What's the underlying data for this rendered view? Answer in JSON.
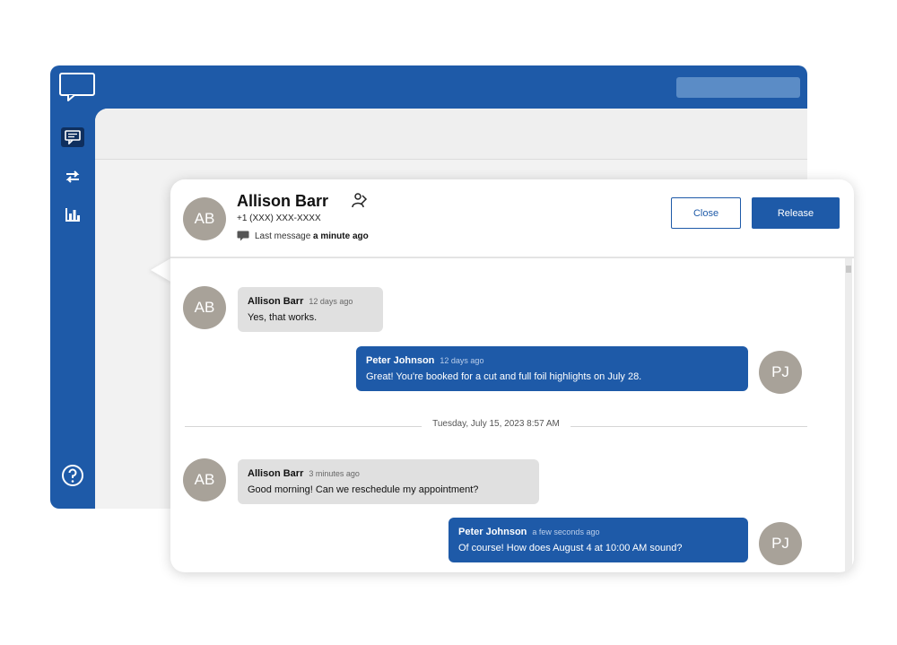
{
  "sidebar": {
    "logo_icon": "chat-bubble-icon",
    "items": [
      {
        "name": "messages",
        "icon": "message-icon",
        "active": true
      },
      {
        "name": "transfers",
        "icon": "transfer-arrows-icon",
        "active": false
      },
      {
        "name": "reports",
        "icon": "bar-chart-icon",
        "active": false
      }
    ],
    "help_icon": "help-icon"
  },
  "conversation": {
    "contact": {
      "initials": "AB",
      "name": "Allison Barr",
      "phone": "+1 (XXX) XXX-XXXX",
      "last_message_prefix": "Last message",
      "last_message_time": "a minute ago"
    },
    "actions": {
      "close_label": "Close",
      "release_label": "Release"
    },
    "messages": [
      {
        "direction": "in",
        "initials": "AB",
        "sender": "Allison Barr",
        "time": "12 days ago",
        "text": "Yes, that works."
      },
      {
        "direction": "out",
        "initials": "PJ",
        "sender": "Peter Johnson",
        "time": "12 days ago",
        "text": "Great! You're booked for a cut and full foil highlights on July 28."
      },
      {
        "direction": "in",
        "initials": "AB",
        "sender": "Allison Barr",
        "time": "3 minutes ago",
        "text": "Good morning! Can we reschedule my appointment?"
      },
      {
        "direction": "out",
        "initials": "PJ",
        "sender": "Peter Johnson",
        "time": "a few seconds ago",
        "text": "Of course! How does August 4 at 10:00 AM sound?"
      }
    ],
    "date_divider": "Tuesday, July 15, 2023 8:57 AM"
  },
  "colors": {
    "brand_blue": "#1e5aa8",
    "avatar_gray": "#a8a299",
    "incoming_bubble": "#e0e0e0"
  }
}
